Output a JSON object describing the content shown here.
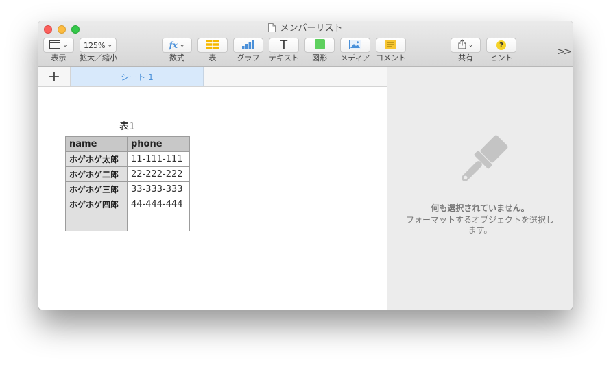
{
  "window": {
    "title": "メンバーリスト"
  },
  "toolbar": {
    "view_label": "表示",
    "zoom_value": "125%",
    "zoom_label": "拡大／縮小",
    "formula_label": "数式",
    "table_label": "表",
    "chart_label": "グラフ",
    "text_label": "テキスト",
    "shape_label": "図形",
    "media_label": "メディア",
    "comment_label": "コメント",
    "share_label": "共有",
    "hint_label": "ヒント",
    "text_glyph": "T",
    "formula_glyph": "fx",
    "hint_glyph": "?",
    "more_glyph": ">>"
  },
  "sheets": {
    "add_glyph": "+",
    "active_tab": "シート 1"
  },
  "table": {
    "title": "表1",
    "headers": [
      "name",
      "phone"
    ],
    "rows": [
      [
        "ホゲホゲ太郎",
        "11-111-111"
      ],
      [
        "ホゲホゲ二郎",
        "22-222-222"
      ],
      [
        "ホゲホゲ三郎",
        "33-333-333"
      ],
      [
        "ホゲホゲ四郎",
        "44-444-444"
      ],
      [
        "",
        ""
      ]
    ]
  },
  "inspector": {
    "empty_title": "何も選択されていません。",
    "empty_desc": "フォーマットするオブジェクトを選択します。"
  },
  "colors": {
    "close": "#fc605c",
    "minimize": "#fdbc40",
    "maximize": "#34c84a",
    "accent_blue": "#4a90d9",
    "table_icon": "#f5b800",
    "shape_icon": "#5ed05e",
    "comment_icon": "#f7c531",
    "hint_icon": "#f5d227"
  }
}
